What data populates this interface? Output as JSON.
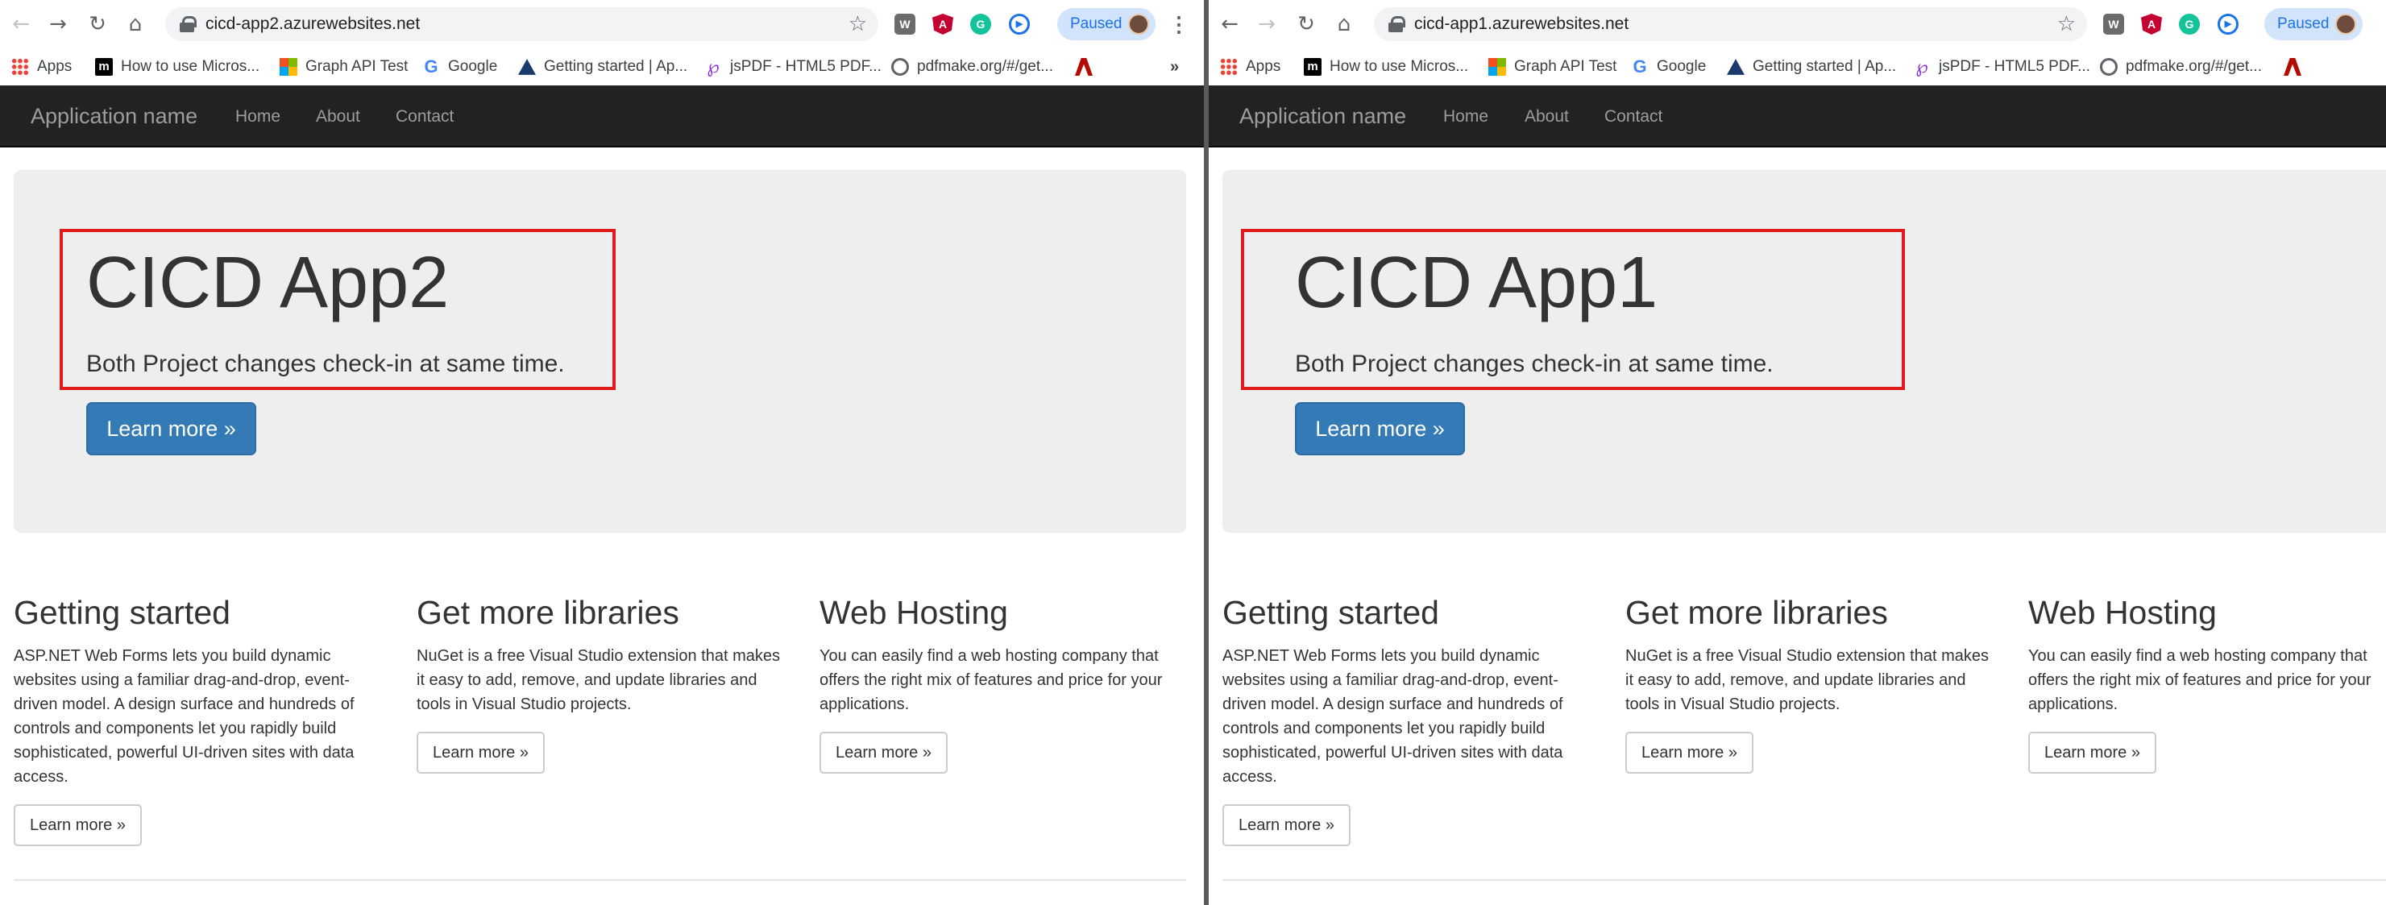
{
  "bookmarks": [
    {
      "label": "Apps",
      "icon": "apps-grid-icon"
    },
    {
      "label": "How to use Micros...",
      "icon": "m-logo-icon"
    },
    {
      "label": "Graph API Test",
      "icon": "microsoft-logo-icon"
    },
    {
      "label": "Google",
      "icon": "google-icon"
    },
    {
      "label": "Getting started | Ap...",
      "icon": "triangle-logo-icon"
    },
    {
      "label": "jsPDF - HTML5 PDF...",
      "icon": "p-logo-icon"
    },
    {
      "label": "pdfmake.org/#/get...",
      "icon": "globe-icon"
    },
    {
      "label": "",
      "icon": "adobe-icon"
    }
  ],
  "bookmarks_overflow": "»",
  "paused_label": "Paused",
  "navbar": {
    "brand": "Application name",
    "links": [
      "Home",
      "About",
      "Contact"
    ]
  },
  "columns": [
    {
      "title": "Getting started",
      "text": "ASP.NET Web Forms lets you build dynamic websites using a familiar drag-and-drop, event-driven model. A design surface and hundreds of controls and components let you rapidly build sophisticated, powerful UI-driven sites with data access.",
      "button": "Learn more »"
    },
    {
      "title": "Get more libraries",
      "text": "NuGet is a free Visual Studio extension that makes it easy to add, remove, and update libraries and tools in Visual Studio projects.",
      "button": "Learn more »"
    },
    {
      "title": "Web Hosting",
      "text": "You can easily find a web hosting company that offers the right mix of features and price for your applications.",
      "button": "Learn more »"
    }
  ],
  "windows": [
    {
      "url": "cicd-app2.azurewebsites.net",
      "hero_title": "CICD App2",
      "hero_lead": "Both Project changes check-in at same time.",
      "hero_button": "Learn more »"
    },
    {
      "url": "cicd-app1.azurewebsites.net",
      "hero_title": "CICD App1",
      "hero_lead": "Both Project changes check-in at same time.",
      "hero_button": "Learn more »"
    }
  ],
  "colors": {
    "navbar": "#222222",
    "jumbotron": "#eeeeee",
    "primary": "#337ab7",
    "highlight": "#e11b1b"
  }
}
